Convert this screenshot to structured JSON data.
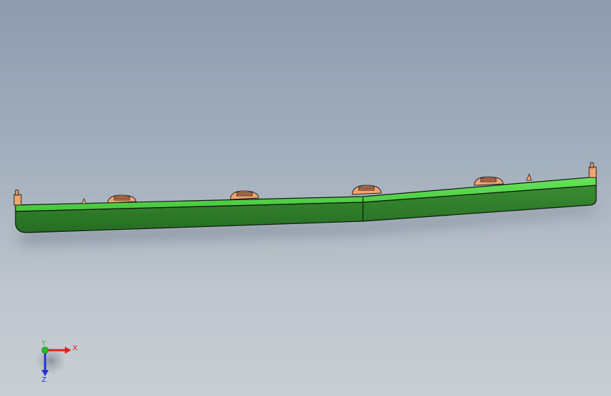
{
  "viewport": {
    "background_top": "#8d9bae",
    "background_bottom": "#c9ced3"
  },
  "model": {
    "part_color_top": "#56d64a",
    "part_color_side": "#2f7d2b",
    "boss_color": "#f2a56f",
    "edge_color": "#0b1a0b",
    "clip_count": 4,
    "tab_count": 2
  },
  "triad": {
    "x_label": "X",
    "y_label": "Y",
    "z_label": "Z",
    "x_color": "#e02020",
    "y_color": "#22c022",
    "z_color": "#2230d0"
  }
}
